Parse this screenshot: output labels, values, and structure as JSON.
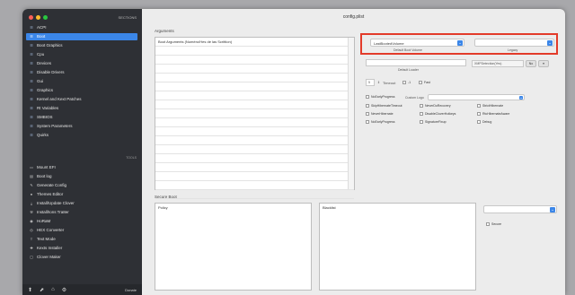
{
  "window": {
    "title": "config.plist"
  },
  "sidebar": {
    "header": "SECTIONS",
    "items": [
      {
        "label": "ACPI"
      },
      {
        "label": "Boot"
      },
      {
        "label": "Boot Graphics"
      },
      {
        "label": "Cpu"
      },
      {
        "label": "Devices"
      },
      {
        "label": "Disable Drivers"
      },
      {
        "label": "Gui"
      },
      {
        "label": "Graphics"
      },
      {
        "label": "Kernel and Kext Patches"
      },
      {
        "label": "Rt Variables"
      },
      {
        "label": "SMBIOS"
      },
      {
        "label": "System Parameters"
      },
      {
        "label": "Quirks"
      }
    ],
    "tools_header": "TOOLS",
    "tools": [
      {
        "label": "Mount EFI"
      },
      {
        "label": "Boot log"
      },
      {
        "label": "Generate Config"
      },
      {
        "label": "Themes Editor"
      },
      {
        "label": "Install/Update Clover"
      },
      {
        "label": "Install/Ions Tra8er"
      },
      {
        "label": "HoRaM"
      },
      {
        "label": "HEX Converter"
      },
      {
        "label": "Text Mode"
      },
      {
        "label": "Kexts Installer"
      },
      {
        "label": "Clover Maker"
      }
    ],
    "bottom_label": "Donate"
  },
  "main": {
    "arguments_label": "Arguments",
    "arguments_rows": [
      "Boot Arguments (Numéro/Hes de las Scrittion)",
      "",
      "",
      "",
      "",
      "",
      "",
      "",
      "",
      "",
      "",
      "",
      "",
      "",
      "",
      "",
      "",
      ""
    ],
    "default_boot_popup": "LastBootedVolume",
    "default_boot_caption": "Default Boot Volume",
    "legacy_caption": "Legacy",
    "default_loader_caption": "Default Loader",
    "xmp_field": "XMPDetection(Yes)",
    "timeout_value": "5",
    "timeout_label": "Timeout",
    "timeout_unit": "-1",
    "fast_label": "Fast",
    "custom_logo_label": "Custom Logo",
    "checkboxes": [
      "NeverHibernate",
      "NeverDoRecovery",
      "StrictHibernate",
      "SkipHibernateTimeout",
      "DisableCloverHotkeys",
      "NoEarlyProgress",
      "RtcHibernateAware",
      "SignatureFixup",
      "Debug"
    ],
    "secure_boot_label": "Secure Boot",
    "lower_left_header": "Policy",
    "lower_right_header": "Blacklist",
    "secure_label": "Secure"
  }
}
